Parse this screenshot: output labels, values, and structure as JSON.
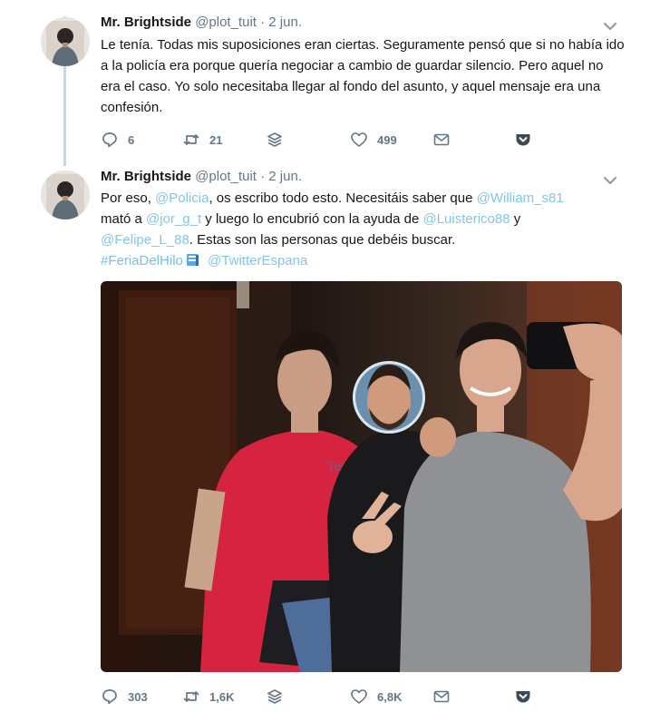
{
  "tweets": [
    {
      "author_name": "Mr. Brightside",
      "handle": "@plot_tuit",
      "separator": "·",
      "date": "2 jun.",
      "text": "Le tenía. Todas mis suposiciones eran ciertas. Seguramente pensó que si no había ido a la policía era porque quería negociar a cambio de guardar silencio. Pero aquel no era el caso. Yo solo necesitaba llegar al fondo del asunto, y aquel mensaje era una confesión.",
      "replies": "6",
      "retweets": "21",
      "likes": "499"
    },
    {
      "author_name": "Mr. Brightside",
      "handle": "@plot_tuit",
      "separator": "·",
      "date": "2 jun.",
      "text_parts": {
        "p1": "Por eso, ",
        "m1": "@Policia",
        "p2": ", os escribo todo esto. Necesitáis saber que ",
        "m2": "@William_s81",
        "p3": "mató a ",
        "m3": "@jor_g_t",
        "p4": " y luego lo encubrió con la ayuda de ",
        "m4": "@Luisterico88",
        "p5": " y",
        "m5": "@Felipe_L_88",
        "p6": ". Estas son las personas que debéis buscar.",
        "h1": "#FeriaDelHilo",
        "m6": "@TwitterEspana"
      },
      "replies": "303",
      "retweets": "1,6K",
      "likes": "6,8K"
    }
  ],
  "colors": {
    "link": "#1b95e0",
    "muted": "#657786",
    "thread_line": "#ccd6dd"
  },
  "icons": [
    "reply-icon",
    "retweet-icon",
    "layers-icon",
    "heart-icon",
    "envelope-icon",
    "pocket-icon",
    "chevron-down-icon"
  ]
}
